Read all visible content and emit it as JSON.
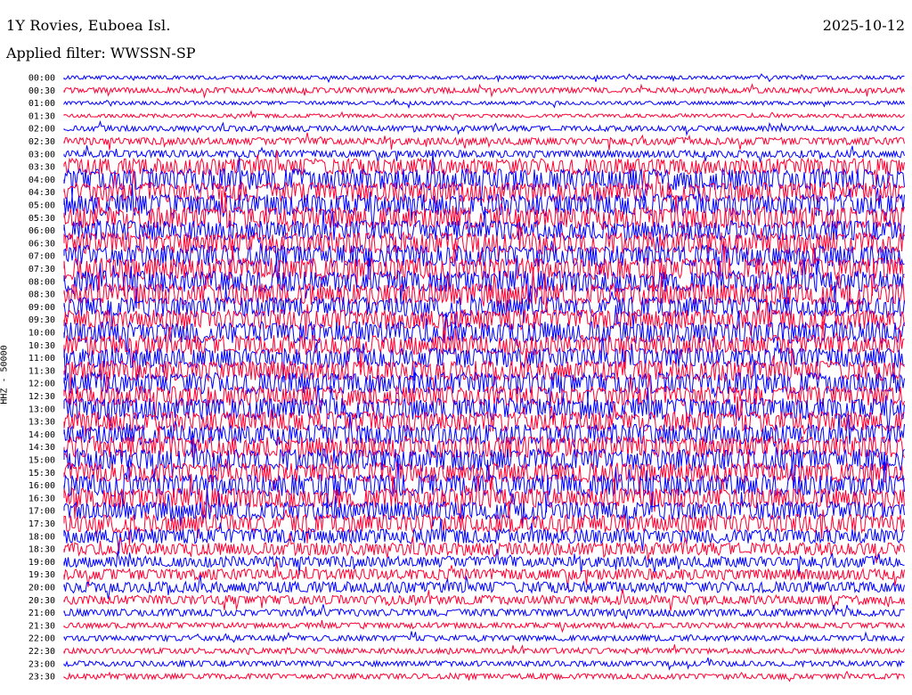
{
  "header": {
    "station": "1Y Rovies, Euboea Isl.",
    "date": "2025-10-12",
    "filter": "Applied filter: WWSSN-SP"
  },
  "chart_data": {
    "type": "line",
    "subtype": "helicorder",
    "ylabel": "HHZ - 50000",
    "colors": [
      "#0000ff",
      "#ff0033"
    ],
    "rows": [
      {
        "label": "00:00",
        "amp": 2
      },
      {
        "label": "00:30",
        "amp": 3
      },
      {
        "label": "01:00",
        "amp": 2
      },
      {
        "label": "01:30",
        "amp": 2
      },
      {
        "label": "02:00",
        "amp": 3
      },
      {
        "label": "02:30",
        "amp": 4
      },
      {
        "label": "03:00",
        "amp": 4
      },
      {
        "label": "03:30",
        "amp": 9
      },
      {
        "label": "04:00",
        "amp": 12
      },
      {
        "label": "04:30",
        "amp": 11
      },
      {
        "label": "05:00",
        "amp": 12
      },
      {
        "label": "05:30",
        "amp": 12
      },
      {
        "label": "06:00",
        "amp": 11
      },
      {
        "label": "06:30",
        "amp": 12
      },
      {
        "label": "07:00",
        "amp": 12
      },
      {
        "label": "07:30",
        "amp": 12
      },
      {
        "label": "08:00",
        "amp": 12
      },
      {
        "label": "08:30",
        "amp": 12
      },
      {
        "label": "09:00",
        "amp": 11
      },
      {
        "label": "09:30",
        "amp": 11
      },
      {
        "label": "10:00",
        "amp": 12
      },
      {
        "label": "10:30",
        "amp": 11
      },
      {
        "label": "11:00",
        "amp": 11
      },
      {
        "label": "11:30",
        "amp": 11
      },
      {
        "label": "12:00",
        "amp": 12
      },
      {
        "label": "12:30",
        "amp": 11
      },
      {
        "label": "13:00",
        "amp": 12
      },
      {
        "label": "13:30",
        "amp": 11
      },
      {
        "label": "14:00",
        "amp": 11
      },
      {
        "label": "14:30",
        "amp": 12
      },
      {
        "label": "15:00",
        "amp": 12
      },
      {
        "label": "15:30",
        "amp": 11
      },
      {
        "label": "16:00",
        "amp": 12
      },
      {
        "label": "16:30",
        "amp": 11
      },
      {
        "label": "17:00",
        "amp": 10
      },
      {
        "label": "17:30",
        "amp": 10
      },
      {
        "label": "18:00",
        "amp": 8
      },
      {
        "label": "18:30",
        "amp": 7
      },
      {
        "label": "19:00",
        "amp": 6
      },
      {
        "label": "19:30",
        "amp": 6
      },
      {
        "label": "20:00",
        "amp": 6
      },
      {
        "label": "20:30",
        "amp": 5
      },
      {
        "label": "21:00",
        "amp": 4
      },
      {
        "label": "21:30",
        "amp": 3
      },
      {
        "label": "22:00",
        "amp": 3
      },
      {
        "label": "22:30",
        "amp": 3
      },
      {
        "label": "23:00",
        "amp": 3
      },
      {
        "label": "23:30",
        "amp": 3
      }
    ]
  }
}
